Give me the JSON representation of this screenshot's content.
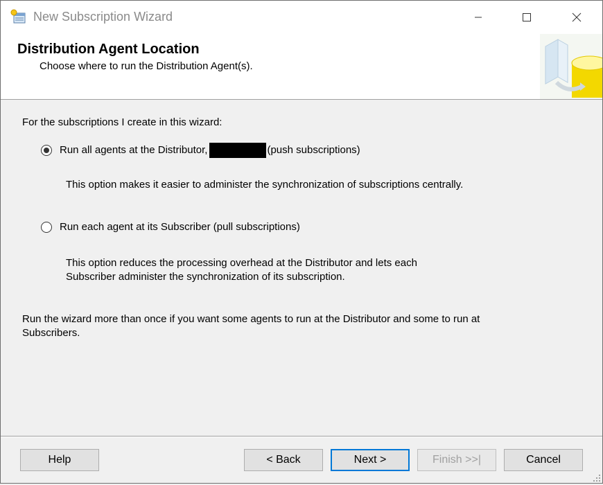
{
  "window": {
    "title": "New Subscription Wizard"
  },
  "header": {
    "title": "Distribution Agent Location",
    "subtitle": "Choose where to run the Distribution Agent(s)."
  },
  "content": {
    "intro": "For the subscriptions I create in this wizard:",
    "option_push": {
      "label_before": "Run all agents at the Distributor,",
      "label_after": "(push subscriptions)",
      "checked": true,
      "description": "This option makes it easier to administer the synchronization of subscriptions centrally."
    },
    "option_pull": {
      "label": "Run each agent at its Subscriber (pull subscriptions)",
      "checked": false,
      "description_line1": "This option reduces the processing overhead at the Distributor and lets each",
      "description_line2": "Subscriber administer the synchronization of its subscription."
    },
    "note_line1": "Run the wizard more than once if you want some agents to run at the Distributor and some to run at",
    "note_line2": "Subscribers."
  },
  "buttons": {
    "help": "Help",
    "back": "< Back",
    "next": "Next >",
    "finish": "Finish >>|",
    "cancel": "Cancel"
  },
  "colors": {
    "accent": "#0078d7",
    "disabled_text": "#a0a0a0"
  }
}
